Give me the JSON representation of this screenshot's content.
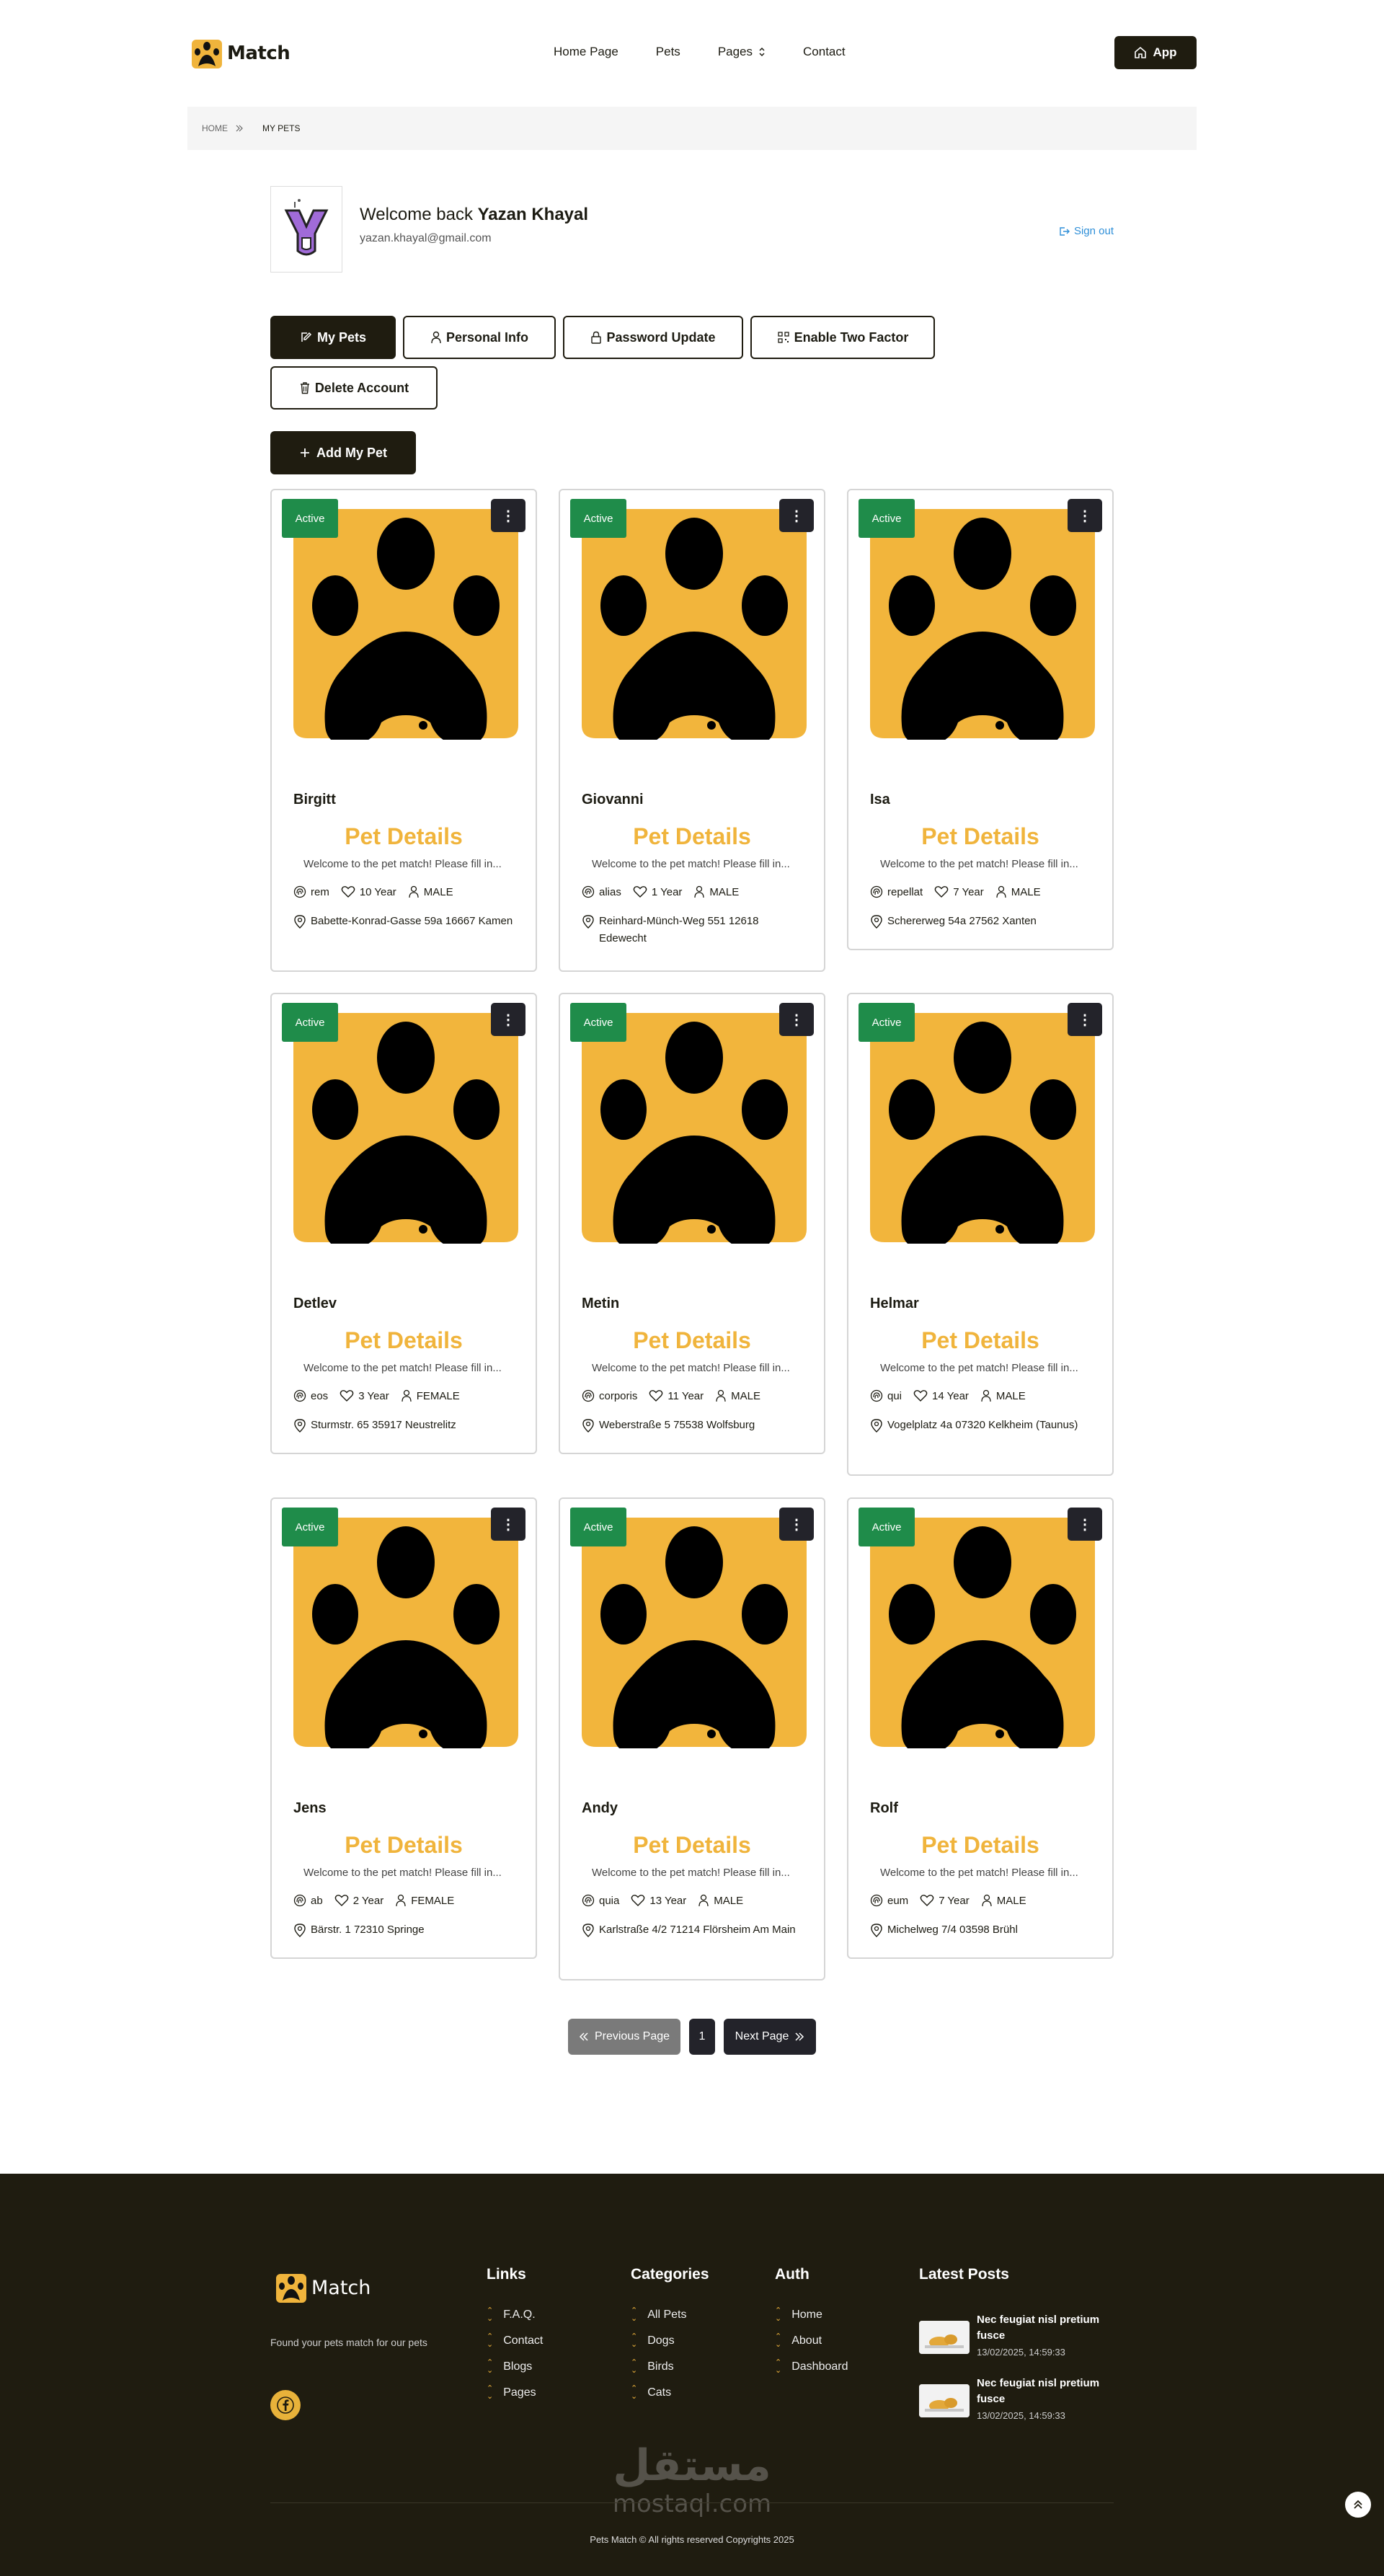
{
  "header": {
    "logo_text": "Match",
    "nav": [
      {
        "label": "Home Page"
      },
      {
        "label": "Pets"
      },
      {
        "label": "Pages"
      },
      {
        "label": "Contact"
      }
    ],
    "app_button": "App"
  },
  "breadcrumb": {
    "home": "HOME",
    "current": "MY PETS"
  },
  "profile": {
    "welcome_prefix": "Welcome back ",
    "user_name": "Yazan Khayal",
    "email": "yazan.khayal@gmail.com",
    "sign_out": "Sign out"
  },
  "tabs": [
    {
      "label": "My Pets",
      "icon": "edit-icon",
      "active": true
    },
    {
      "label": "Personal Info",
      "icon": "user-icon"
    },
    {
      "label": "Password Update",
      "icon": "lock-icon"
    },
    {
      "label": "Enable Two Factor",
      "icon": "qr-icon"
    },
    {
      "label": "Delete Account",
      "icon": "trash-icon"
    }
  ],
  "add_pet_button": "Add My Pet",
  "pets": [
    {
      "status": "Active",
      "name": "Birgitt",
      "details_title": "Pet Details",
      "description": "Welcome to the pet match! Please fill in...",
      "breed": "rem",
      "age": "10 Year",
      "gender": "MALE",
      "address": "Babette-Konrad-Gasse 59a 16667 Kamen"
    },
    {
      "status": "Active",
      "name": "Giovanni",
      "details_title": "Pet Details",
      "description": "Welcome to the pet match! Please fill in...",
      "breed": "alias",
      "age": "1 Year",
      "gender": "MALE",
      "address": "Reinhard-Münch-Weg 551 12618 Edewecht"
    },
    {
      "status": "Active",
      "name": "Isa",
      "details_title": "Pet Details",
      "description": "Welcome to the pet match! Please fill in...",
      "breed": "repellat",
      "age": "7 Year",
      "gender": "MALE",
      "address": "Schererweg 54a 27562 Xanten"
    },
    {
      "status": "Active",
      "name": "Detlev",
      "details_title": "Pet Details",
      "description": "Welcome to the pet match! Please fill in...",
      "breed": "eos",
      "age": "3 Year",
      "gender": "FEMALE",
      "address": "Sturmstr. 65 35917 Neustrelitz"
    },
    {
      "status": "Active",
      "name": "Metin",
      "details_title": "Pet Details",
      "description": "Welcome to the pet match! Please fill in...",
      "breed": "corporis",
      "age": "11 Year",
      "gender": "MALE",
      "address": "Weberstraße 5 75538 Wolfsburg"
    },
    {
      "status": "Active",
      "name": "Helmar",
      "details_title": "Pet Details",
      "description": "Welcome to the pet match! Please fill in...",
      "breed": "qui",
      "age": "14 Year",
      "gender": "MALE",
      "address": "Vogelplatz 4a 07320 Kelkheim (Taunus)"
    },
    {
      "status": "Active",
      "name": "Jens",
      "details_title": "Pet Details",
      "description": "Welcome to the pet match! Please fill in...",
      "breed": "ab",
      "age": "2 Year",
      "gender": "FEMALE",
      "address": "Bärstr. 1 72310 Springe"
    },
    {
      "status": "Active",
      "name": "Andy",
      "details_title": "Pet Details",
      "description": "Welcome to the pet match! Please fill in...",
      "breed": "quia",
      "age": "13 Year",
      "gender": "MALE",
      "address": "Karlstraße 4/2 71214 Flörsheim Am Main"
    },
    {
      "status": "Active",
      "name": "Rolf",
      "details_title": "Pet Details",
      "description": "Welcome to the pet match! Please fill in...",
      "breed": "eum",
      "age": "7 Year",
      "gender": "MALE",
      "address": "Michelweg 7/4 03598 Brühl"
    }
  ],
  "pagination": {
    "previous": "Previous Page",
    "current_page": "1",
    "next": "Next Page"
  },
  "footer": {
    "logo_text": "Match",
    "tagline": "Found your pets match for our pets",
    "links": {
      "title": "Links",
      "items": [
        "F.A.Q.",
        "Contact",
        "Blogs",
        "Pages"
      ]
    },
    "categories": {
      "title": "Categories",
      "items": [
        "All Pets",
        "Dogs",
        "Birds",
        "Cats"
      ]
    },
    "auth": {
      "title": "Auth",
      "items": [
        "Home",
        "About",
        "Dashboard"
      ]
    },
    "latest_posts": {
      "title": "Latest Posts",
      "items": [
        {
          "title": "Nec feugiat nisl pretium fusce",
          "date": "13/02/2025, 14:59:33"
        },
        {
          "title": "Nec feugiat nisl pretium fusce",
          "date": "13/02/2025, 14:59:33"
        }
      ]
    },
    "watermark_ar": "مستقل",
    "watermark_en": "mostaql.com",
    "copyright": "Pets Match © All rights reserved Copyrights 2025"
  },
  "colors": {
    "primary_dark": "#1f1c10",
    "accent_yellow": "#f0b43c",
    "active_green": "#1f8c4a",
    "link_blue": "#2f8fd8"
  }
}
